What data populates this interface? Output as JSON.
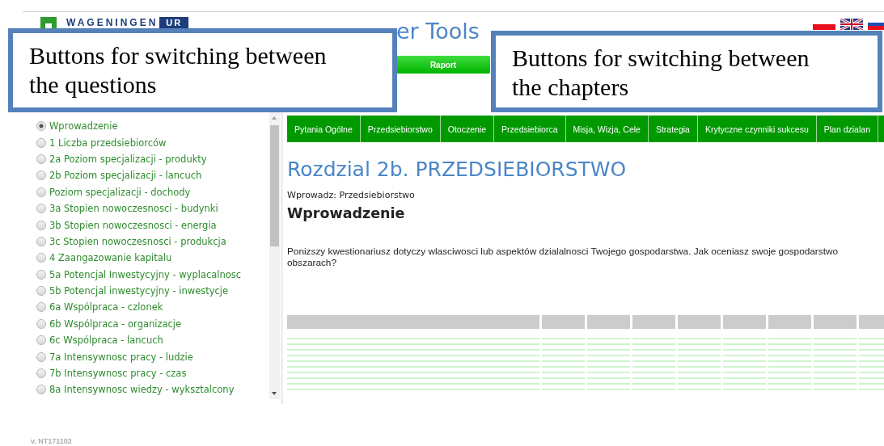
{
  "header": {
    "logo": {
      "name": "WAGENINGEN",
      "badge": "UR"
    },
    "title": "er Tools",
    "report_button": "Raport",
    "flags": [
      {
        "kind": "poland"
      },
      {
        "kind": "uk"
      },
      {
        "kind": "slovenia"
      }
    ]
  },
  "callouts": [
    {
      "text": "Buttons for switching between the questions"
    },
    {
      "text": "Buttons for switching between the chapters"
    }
  ],
  "questions": [
    {
      "label": "Wprowadzenie",
      "selected": true
    },
    {
      "label": "1 Liczba przedsiebiorców",
      "selected": false
    },
    {
      "label": "2a Poziom specjalizacji - produkty",
      "selected": false
    },
    {
      "label": "2b Poziom specjalizacji - lancuch",
      "selected": false
    },
    {
      "label": "Poziom specjalizacji - dochody",
      "selected": false
    },
    {
      "label": "3a Stopien nowoczesnosci - budynki",
      "selected": false
    },
    {
      "label": "3b Stopien nowoczesnosci - energia",
      "selected": false
    },
    {
      "label": "3c Stopien nowoczesnosci - produkcja",
      "selected": false
    },
    {
      "label": "4 Zaangazowanie kapitalu",
      "selected": false
    },
    {
      "label": "5a Potencjal Inwestycyjny - wyplacalnosc",
      "selected": false
    },
    {
      "label": "5b Potencjal inwestycyjny - inwestycje",
      "selected": false
    },
    {
      "label": "6a Wspólpraca - czlonek",
      "selected": false
    },
    {
      "label": "6b Wspólpraca - organizacje",
      "selected": false
    },
    {
      "label": "6c Wspólpraca - lancuch",
      "selected": false
    },
    {
      "label": "7a Intensywnosc pracy - ludzie",
      "selected": false
    },
    {
      "label": "7b Intensywnosc pracy - czas",
      "selected": false
    },
    {
      "label": "8a Intensywnosc wiedzy - wyksztalcony",
      "selected": false
    }
  ],
  "chapter_tabs": [
    {
      "label": "Pytania Ogólne"
    },
    {
      "label": "Przedsiebiorstwo"
    },
    {
      "label": "Otoczenie"
    },
    {
      "label": "Przedsiebiorca"
    },
    {
      "label": "Misja, Wizja, Cele"
    },
    {
      "label": "Strategia"
    },
    {
      "label": "Krytyczne czynniki sukcesu"
    },
    {
      "label": "Plan dzialan"
    }
  ],
  "chapter": {
    "title": "Rozdzial 2b. PRZEDSIEBIORSTWO",
    "breadcrumb": "Wprowadz: Przedsiebiorstwo",
    "section": "Wprowadzenie",
    "intro_lines": [
      "Ponizszy kwestionariusz dotyczy wlasciwosci lub aspektów dzialalnosci Twojego gospodarstwa. Jak oceniasz swoje gospodarstwo",
      "obszarach?"
    ]
  },
  "version": "v. NT171102"
}
